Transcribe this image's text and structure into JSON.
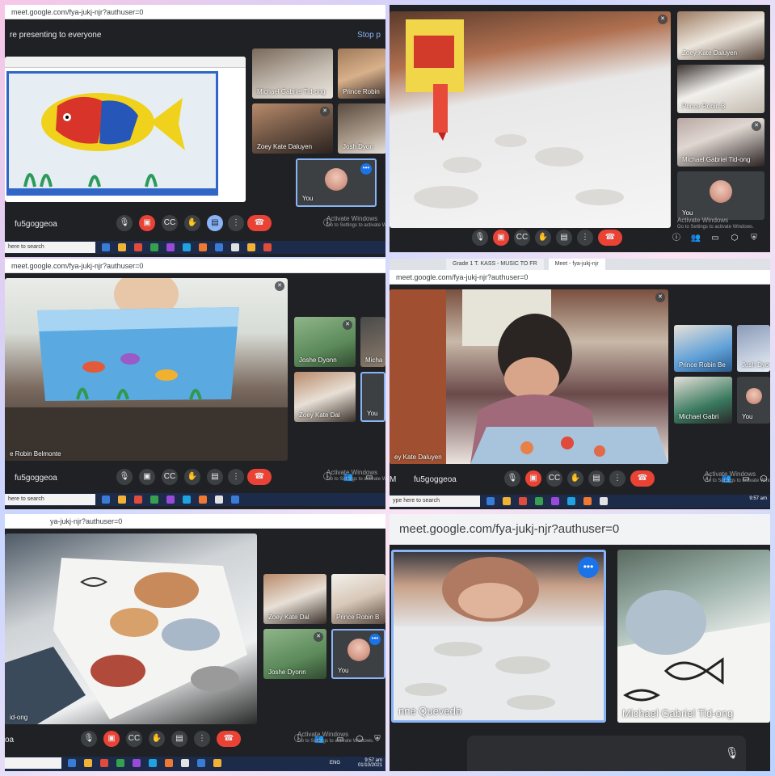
{
  "colors": {
    "meet_bg": "#202124",
    "hangup": "#ea4335",
    "accent": "#8ab4f8",
    "taskbar": "#1c2b4a"
  },
  "panel1": {
    "url": "meet.google.com/fya-jukj-njr?authuser=0",
    "banner": "re presenting to everyone",
    "stop_label": "Stop p",
    "tiles": [
      "Michael Gabriel Tid-ong",
      "Prince Robin",
      "Zoey Kate Daluyen",
      "Josh Dyon"
    ],
    "you_label": "You",
    "meeting_code": "fu5goggeoa",
    "activate": "Activate Windows",
    "activate_sub": "Go to Settings to activate Windows.",
    "search": "here to search"
  },
  "panel2": {
    "tiles": [
      "Zoey Kate Daluyen",
      "Prince Robin B",
      "Michael Gabriel Tid-ong"
    ],
    "you_label": "You",
    "activate": "Activate Windows",
    "activate_sub": "Go to Settings to activate Windows."
  },
  "panel3": {
    "url": "meet.google.com/fya-jukj-njr?authuser=0",
    "main_name": "e Robin Belmonte",
    "tiles": [
      "Joshe Dyonn",
      "Micha",
      "Zoey Kate Dal",
      "You"
    ],
    "meeting_code": "fu5goggeoa",
    "activate": "Activate Windows",
    "activate_sub": "Go to Settings to activate Windows.",
    "search": "here to search"
  },
  "panel4": {
    "tabs": [
      "Grade 1 T. KASS - MUSIC TO FR",
      "Meet - fya-jukj-njr"
    ],
    "url": "meet.google.com/fya-jukj-njr?authuser=0",
    "main_name": "ey Kate Daluyen",
    "tiles": [
      "Prince Robin Be",
      "Josh Dyonn",
      "Michael Gabri",
      "You"
    ],
    "meeting_code": "fu5goggeoa",
    "meeting_prefix": "M",
    "activate": "Activate Windows",
    "activate_sub": "Go to Settings to activate Windows.",
    "search": "ype here to search",
    "clock": "9:57 am"
  },
  "panel5": {
    "url": "ya-jukj-njr?authuser=0",
    "main_name": "id-ong",
    "tiles": [
      "Zoey Kate Dal",
      "Prince Robin B",
      "Joshe Dyonn",
      "You"
    ],
    "meeting_code": "oa",
    "activate": "Activate Windows",
    "activate_sub": "Go to Settings to activate Windows.",
    "clock": "9:57 am",
    "date": "01/10/2021",
    "lang": "ENG"
  },
  "panel6": {
    "url": "meet.google.com/fya-jukj-njr?authuser=0",
    "tile_left": "nne Quevedo",
    "tile_right": "Michael Gabriel Tid-ong"
  },
  "icons": [
    "mic-icon",
    "camera-off-icon",
    "captions-icon",
    "raise-hand-icon",
    "present-icon",
    "more-icon",
    "hangup-icon",
    "info-icon",
    "people-icon",
    "chat-icon",
    "activities-icon",
    "lock-icon"
  ]
}
